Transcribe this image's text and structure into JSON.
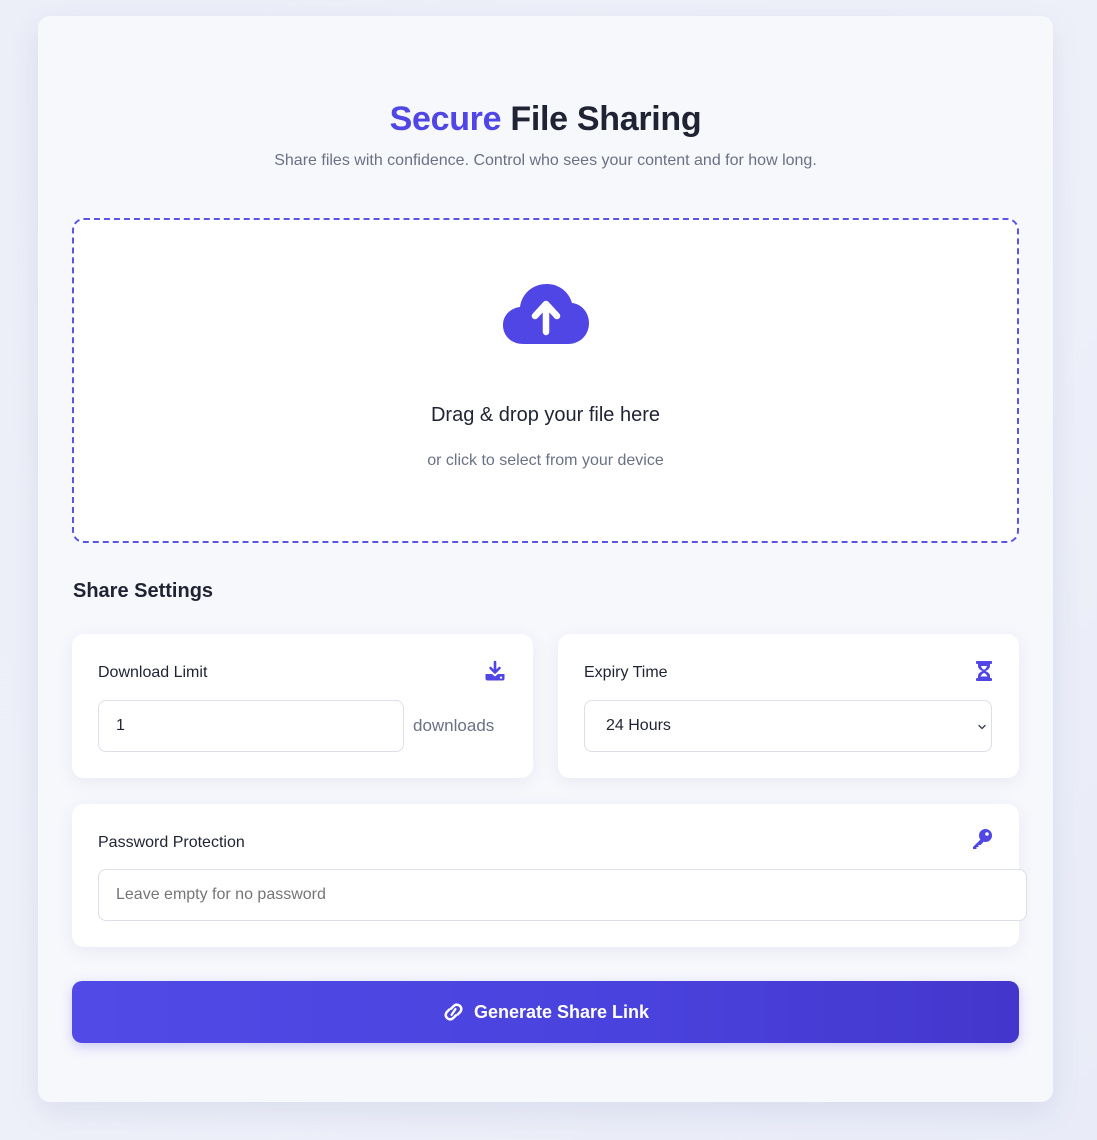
{
  "header": {
    "title_accent": "Secure",
    "title_rest": "File Sharing",
    "subtitle": "Share files with confidence. Control who sees your content and for how long."
  },
  "dropzone": {
    "icon": "cloud-upload-icon",
    "title": "Drag & drop your file here",
    "subtitle": "or click to select from your device"
  },
  "settings": {
    "heading": "Share Settings",
    "download_limit": {
      "label": "Download Limit",
      "icon": "download-icon",
      "value": "1",
      "unit": "downloads"
    },
    "expiry": {
      "label": "Expiry Time",
      "icon": "hourglass-icon",
      "selected": "24 Hours"
    },
    "password": {
      "label": "Password Protection",
      "icon": "key-icon",
      "placeholder": "Leave empty for no password",
      "value": ""
    }
  },
  "actions": {
    "generate_label": "Generate Share Link",
    "generate_icon": "link-icon"
  },
  "colors": {
    "accent": "#4f46e5",
    "dropzone_border": "#5b55e6",
    "text": "#1f2333",
    "muted": "#6b7184"
  }
}
